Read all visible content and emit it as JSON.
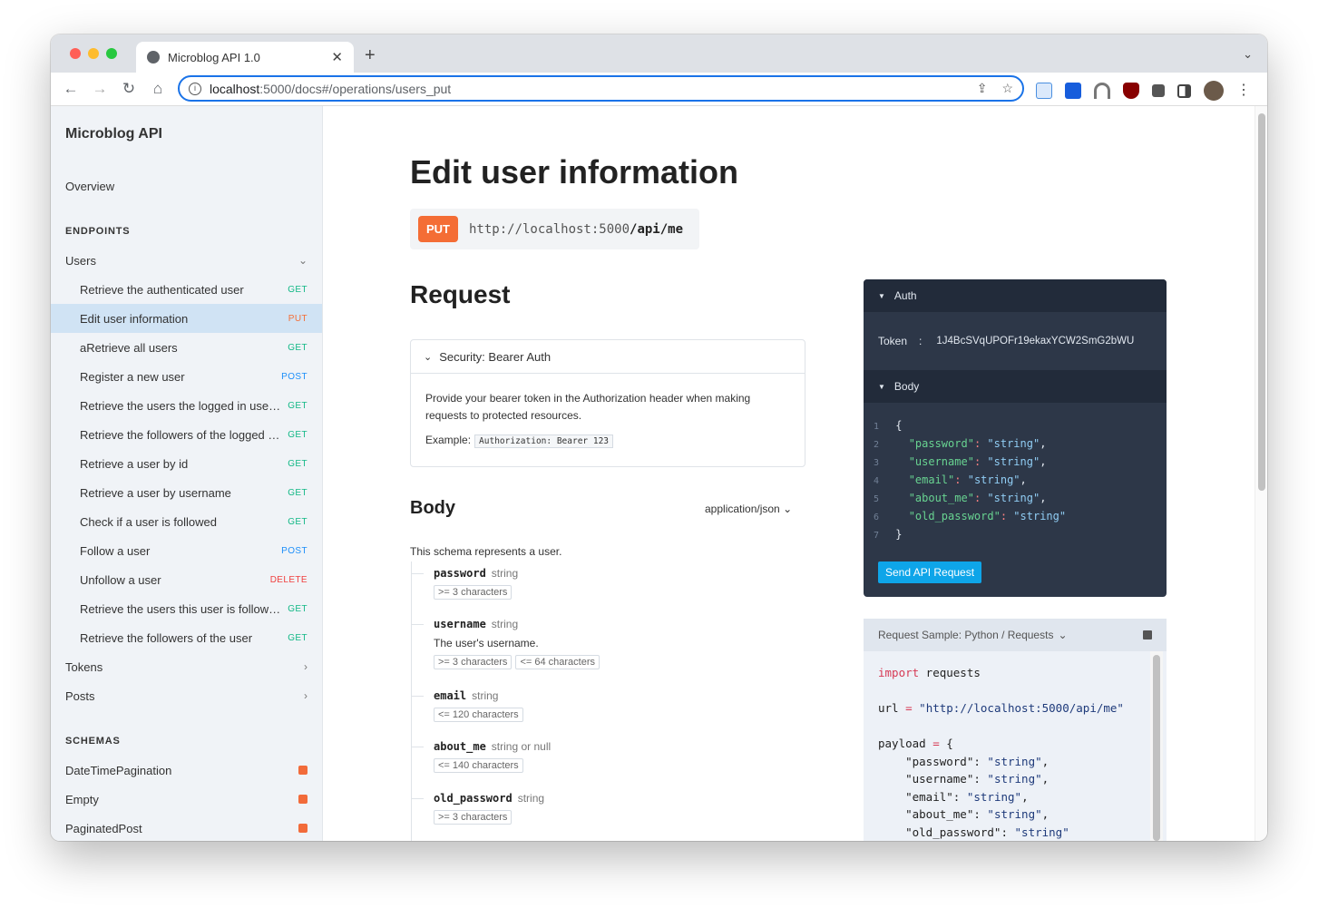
{
  "browser": {
    "tab_title": "Microblog API 1.0",
    "url_host": "localhost",
    "url_rest": ":5000/docs#/operations/users_put"
  },
  "sidebar": {
    "title": "Microblog API",
    "overview": "Overview",
    "endpoints_heading": "ENDPOINTS",
    "groups": [
      {
        "label": "Users"
      },
      {
        "label": "Tokens"
      },
      {
        "label": "Posts"
      }
    ],
    "user_items": [
      {
        "label": "Retrieve the authenticated user",
        "method": "GET"
      },
      {
        "label": "Edit user information",
        "method": "PUT",
        "active": true
      },
      {
        "label": "aRetrieve all users",
        "method": "GET"
      },
      {
        "label": "Register a new user",
        "method": "POST"
      },
      {
        "label": "Retrieve the users the logged in user is following",
        "method": "GET"
      },
      {
        "label": "Retrieve the followers of the logged in user",
        "method": "GET"
      },
      {
        "label": "Retrieve a user by id",
        "method": "GET"
      },
      {
        "label": "Retrieve a user by username",
        "method": "GET"
      },
      {
        "label": "Check if a user is followed",
        "method": "GET"
      },
      {
        "label": "Follow a user",
        "method": "POST"
      },
      {
        "label": "Unfollow a user",
        "method": "DELETE"
      },
      {
        "label": "Retrieve the users this user is following",
        "method": "GET"
      },
      {
        "label": "Retrieve the followers of the user",
        "method": "GET"
      }
    ],
    "schemas_heading": "SCHEMAS",
    "schemas": [
      {
        "label": "DateTimePagination"
      },
      {
        "label": "Empty"
      },
      {
        "label": "PaginatedPost"
      }
    ]
  },
  "method_colors": {
    "GET": "#12b886",
    "PUT": "#f46d35",
    "POST": "#1c8ef9",
    "DELETE": "#f03e3e"
  },
  "main": {
    "title": "Edit user information",
    "method": "PUT",
    "url_base": "http://localhost:5000",
    "url_path": "/api/me",
    "request_heading": "Request",
    "security": {
      "heading": "Security: Bearer Auth",
      "description": "Provide your bearer token in the Authorization header when making requests to protected resources.",
      "example_label": "Example:",
      "example_value": "Authorization: Bearer 123"
    },
    "body_heading": "Body",
    "content_type": "application/json",
    "schema_description": "This schema represents a user.",
    "fields": [
      {
        "name": "password",
        "type": "string",
        "constraints": [
          ">= 3 characters"
        ]
      },
      {
        "name": "username",
        "type": "string",
        "description": "The user's username.",
        "constraints": [
          ">= 3 characters",
          "<= 64 characters"
        ]
      },
      {
        "name": "email",
        "type": "string",
        "constraints": [
          "<= 120 characters"
        ]
      },
      {
        "name": "about_me",
        "type": "string or null",
        "constraints": [
          "<= 140 characters"
        ]
      },
      {
        "name": "old_password",
        "type": "string",
        "constraints": [
          ">= 3 characters"
        ]
      }
    ]
  },
  "try_panel": {
    "auth_heading": "Auth",
    "token_label": "Token",
    "token_sep": ":",
    "token_value": "1J4BcSVqUPOFr19ekaxYCW2SmG2bWU",
    "body_heading": "Body",
    "body_lines": [
      [
        "{"
      ],
      [
        "\"password\"",
        "\"string\"",
        ","
      ],
      [
        "\"username\"",
        "\"string\"",
        ","
      ],
      [
        "\"email\"",
        "\"string\"",
        ","
      ],
      [
        "\"about_me\"",
        "\"string\"",
        ","
      ],
      [
        "\"old_password\"",
        "\"string\"",
        ""
      ],
      [
        "}"
      ]
    ],
    "send_label": "Send API Request"
  },
  "sample": {
    "heading": "Request Sample: Python / Requests",
    "code_lines": [
      "import requests",
      "",
      "url = \"http://localhost:5000/api/me\"",
      "",
      "payload = {",
      "    \"password\": \"string\",",
      "    \"username\": \"string\",",
      "    \"email\": \"string\",",
      "    \"about_me\": \"string\",",
      "    \"old_password\": \"string\""
    ]
  }
}
